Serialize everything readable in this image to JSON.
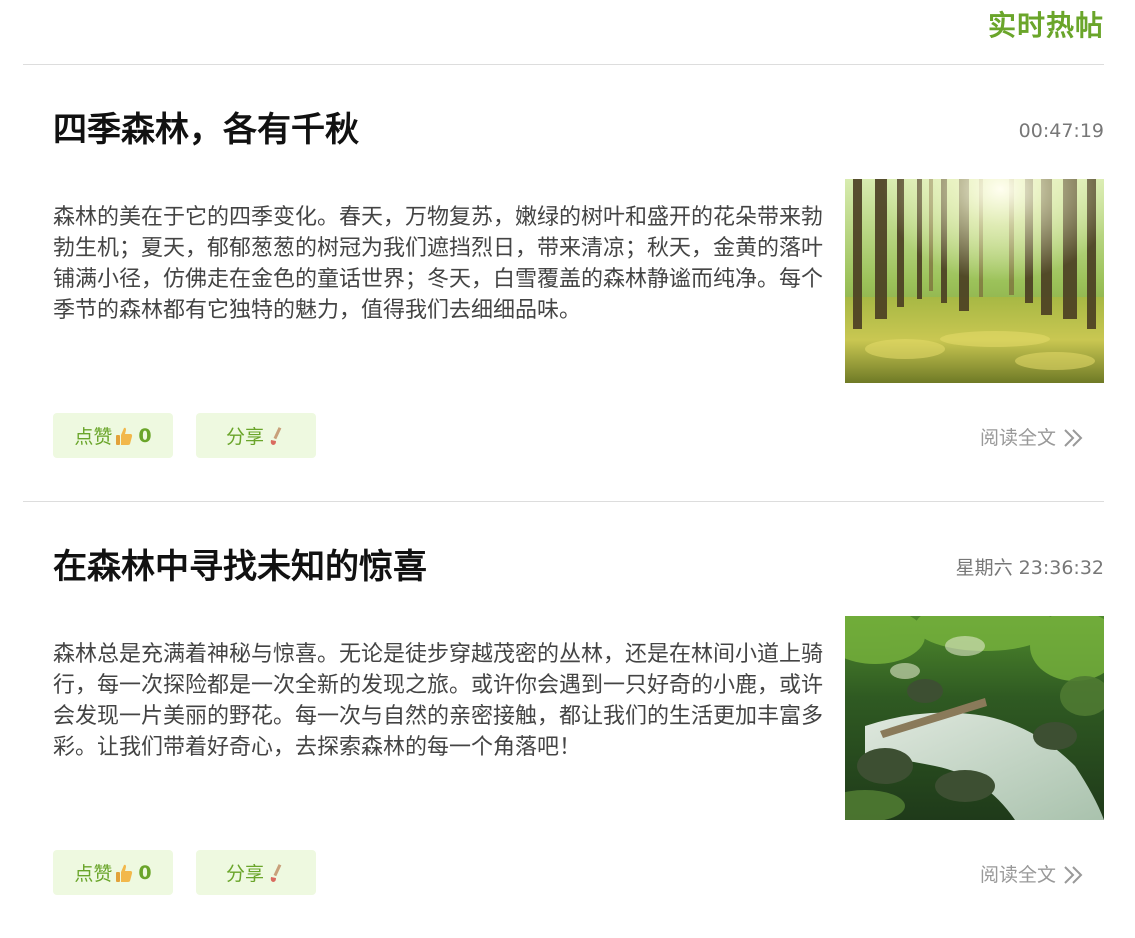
{
  "header": {
    "title": "实时热帖"
  },
  "posts": [
    {
      "title": "四季森林，各有千秋",
      "time": "00:47:19",
      "body": "森林的美在于它的四季变化。春天，万物复苏，嫩绿的树叶和盛开的花朵带来勃勃生机；夏天，郁郁葱葱的树冠为我们遮挡烈日，带来清凉；秋天，金黄的落叶铺满小径，仿佛走在金色的童话世界；冬天，白雪覆盖的森林静谧而纯净。每个季节的森林都有它独特的魅力，值得我们去细细品味。",
      "image_icon": "sunlit-forest-photo",
      "like_label": "点赞",
      "like_icon": "thumbs-up-icon",
      "like_count": "0",
      "share_label": "分享",
      "share_icon": "share-brush-icon",
      "read_more_label": "阅读全文",
      "read_more_icon": "double-chevron-right-icon"
    },
    {
      "title": "在森林中寻找未知的惊喜",
      "time": "星期六 23:36:32",
      "body": "森林总是充满着神秘与惊喜。无论是徒步穿越茂密的丛林，还是在林间小道上骑行，每一次探险都是一次全新的发现之旅。或许你会遇到一只好奇的小鹿，或许会发现一片美丽的野花。每一次与自然的亲密接触，都让我们的生活更加丰富多彩。让我们带着好奇心，去探索森林的每一个角落吧！",
      "image_icon": "forest-stream-photo",
      "like_label": "点赞",
      "like_icon": "thumbs-up-icon",
      "like_count": "0",
      "share_label": "分享",
      "share_icon": "share-brush-icon",
      "read_more_label": "阅读全文",
      "read_more_icon": "double-chevron-right-icon"
    }
  ],
  "colors": {
    "accent": "#6aa52a",
    "button_bg": "#eef9e0",
    "divider": "#dddddd",
    "muted": "#999999",
    "time": "#777777"
  }
}
